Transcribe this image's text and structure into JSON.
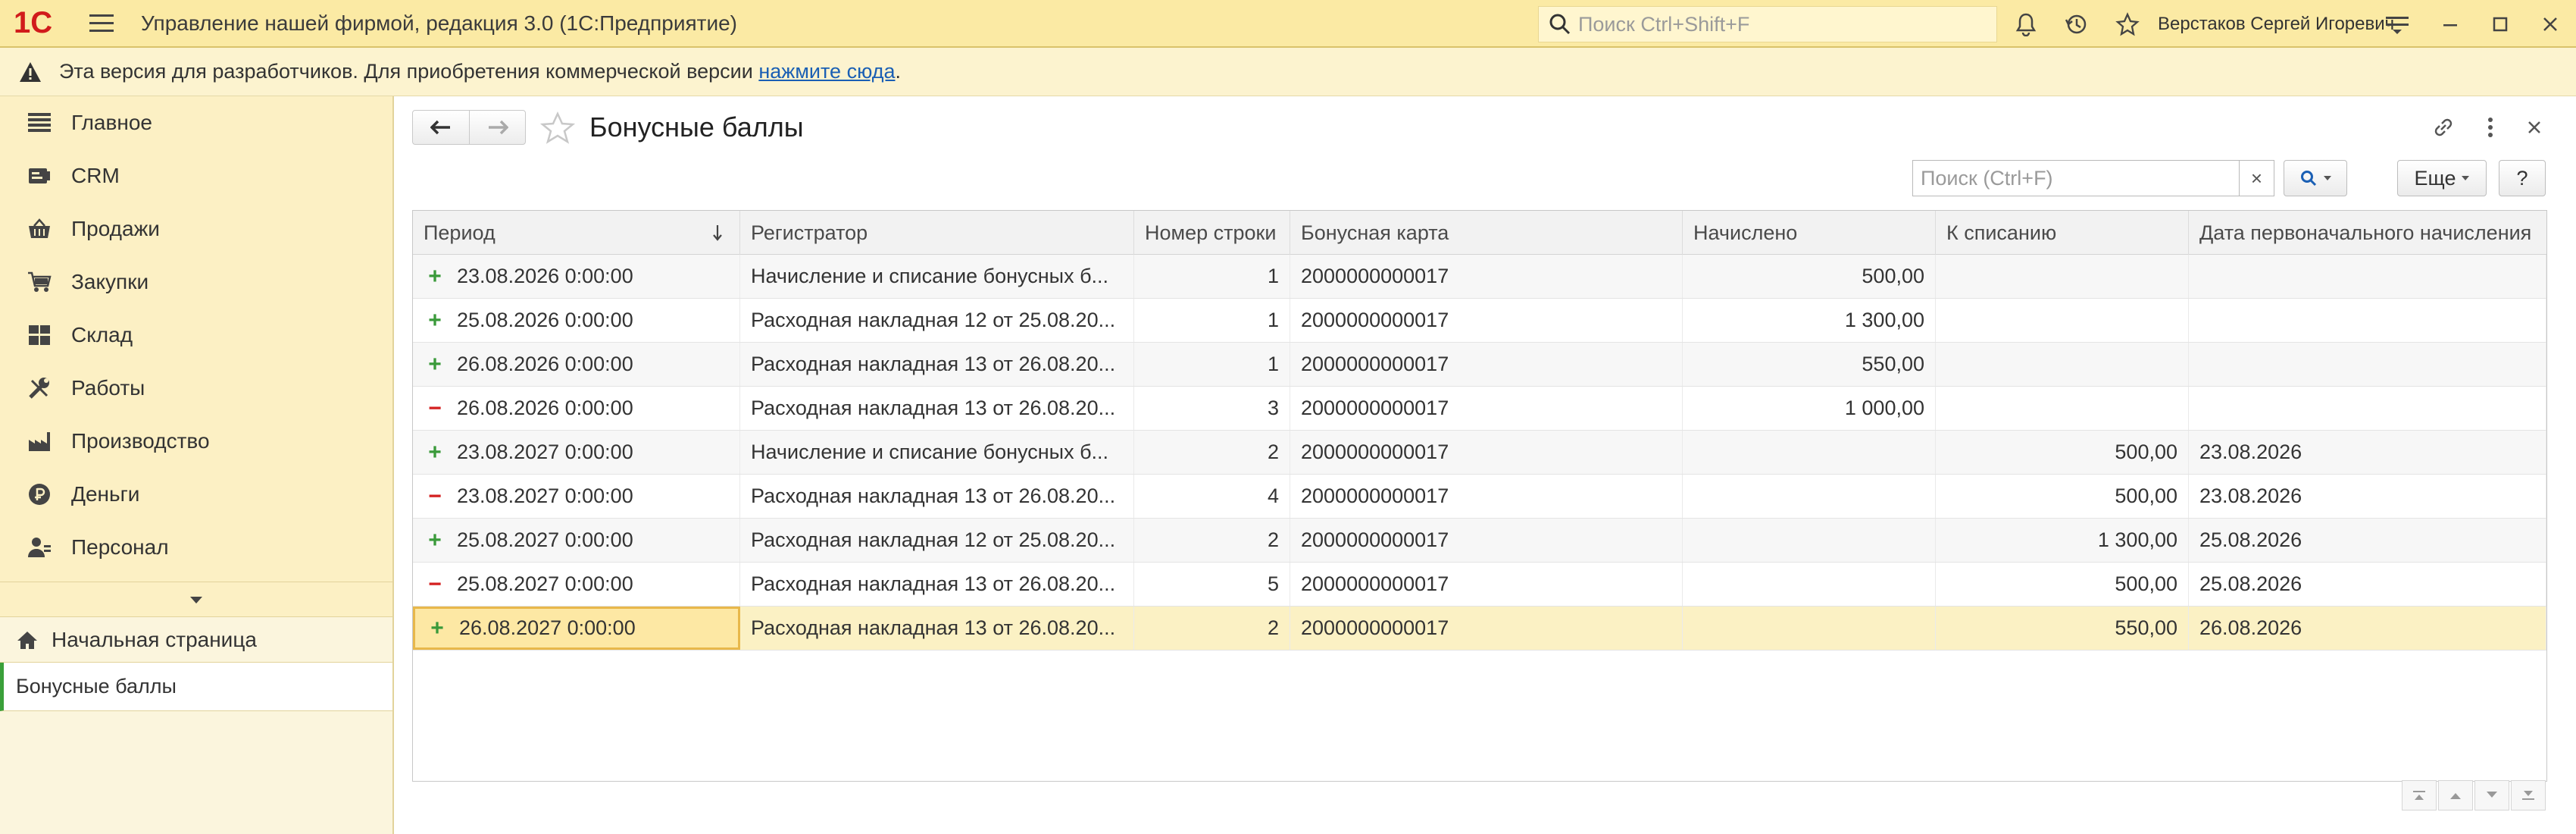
{
  "app": {
    "title": "Управление нашей фирмой, редакция 3.0  (1С:Предприятие)",
    "logo": "1С",
    "search_placeholder": "Поиск Ctrl+Shift+F",
    "user": "Верстаков Сергей Игоревич"
  },
  "banner": {
    "text": "Эта версия для разработчиков. Для приобретения коммерческой версии",
    "link": "нажмите сюда",
    "suffix": "."
  },
  "sidebar": {
    "items": [
      {
        "label": "Главное",
        "icon": "menu-lines-icon"
      },
      {
        "label": "CRM",
        "icon": "crm-icon"
      },
      {
        "label": "Продажи",
        "icon": "basket-icon"
      },
      {
        "label": "Закупки",
        "icon": "cart-icon"
      },
      {
        "label": "Склад",
        "icon": "warehouse-icon"
      },
      {
        "label": "Работы",
        "icon": "tools-icon"
      },
      {
        "label": "Производство",
        "icon": "factory-icon"
      },
      {
        "label": "Деньги",
        "icon": "ruble-icon"
      },
      {
        "label": "Персонал",
        "icon": "person-icon"
      }
    ],
    "home": "Начальная страница",
    "current": "Бонусные баллы"
  },
  "page": {
    "title": "Бонусные баллы",
    "search_placeholder": "Поиск (Ctrl+F)",
    "search_value": "",
    "clear": "×",
    "more_label": "Еще",
    "help_label": "?"
  },
  "table": {
    "columns": [
      "Период",
      "Регистратор",
      "Номер строки",
      "Бонусная карта",
      "Начислено",
      "К списанию",
      "Дата первоначального начисления"
    ],
    "rows": [
      {
        "sign": "+",
        "period": "23.08.2026 0:00:00",
        "registrar": "Начисление и списание бонусных б...",
        "line": "1",
        "card": "2000000000017",
        "accrued": "500,00",
        "writeoff": "",
        "first_date": ""
      },
      {
        "sign": "+",
        "period": "25.08.2026 0:00:00",
        "registrar": "Расходная накладная 12 от 25.08.20...",
        "line": "1",
        "card": "2000000000017",
        "accrued": "1 300,00",
        "writeoff": "",
        "first_date": ""
      },
      {
        "sign": "+",
        "period": "26.08.2026 0:00:00",
        "registrar": "Расходная накладная 13 от 26.08.20...",
        "line": "1",
        "card": "2000000000017",
        "accrued": "550,00",
        "writeoff": "",
        "first_date": ""
      },
      {
        "sign": "−",
        "period": "26.08.2026 0:00:00",
        "registrar": "Расходная накладная 13 от 26.08.20...",
        "line": "3",
        "card": "2000000000017",
        "accrued": "1 000,00",
        "writeoff": "",
        "first_date": ""
      },
      {
        "sign": "+",
        "period": "23.08.2027 0:00:00",
        "registrar": "Начисление и списание бонусных б...",
        "line": "2",
        "card": "2000000000017",
        "accrued": "",
        "writeoff": "500,00",
        "first_date": "23.08.2026"
      },
      {
        "sign": "−",
        "period": "23.08.2027 0:00:00",
        "registrar": "Расходная накладная 13 от 26.08.20...",
        "line": "4",
        "card": "2000000000017",
        "accrued": "",
        "writeoff": "500,00",
        "first_date": "23.08.2026"
      },
      {
        "sign": "+",
        "period": "25.08.2027 0:00:00",
        "registrar": "Расходная накладная 12 от 25.08.20...",
        "line": "2",
        "card": "2000000000017",
        "accrued": "",
        "writeoff": "1 300,00",
        "first_date": "25.08.2026"
      },
      {
        "sign": "−",
        "period": "25.08.2027 0:00:00",
        "registrar": "Расходная накладная 13 от 26.08.20...",
        "line": "5",
        "card": "2000000000017",
        "accrued": "",
        "writeoff": "500,00",
        "first_date": "25.08.2026"
      },
      {
        "sign": "+",
        "period": "26.08.2027 0:00:00",
        "registrar": "Расходная накладная 13 от 26.08.20...",
        "line": "2",
        "card": "2000000000017",
        "accrued": "",
        "writeoff": "550,00",
        "first_date": "26.08.2026"
      }
    ]
  },
  "colors": {
    "titlebar": "#fbeaa4",
    "sidebar": "#fcf0c4",
    "accent_plus": "#3a9a3a",
    "accent_minus": "#d42020",
    "selection": "#fbf1c4"
  }
}
